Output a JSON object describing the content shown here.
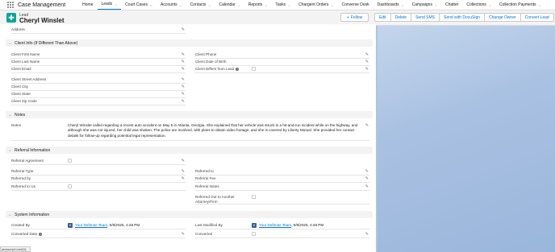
{
  "app": {
    "name": "Case Management"
  },
  "nav": [
    {
      "label": "Home",
      "dropdown": false
    },
    {
      "label": "Leads",
      "dropdown": true,
      "active": true
    },
    {
      "label": "Court Cases",
      "dropdown": true
    },
    {
      "label": "Accounts",
      "dropdown": true
    },
    {
      "label": "Contacts",
      "dropdown": true
    },
    {
      "label": "Calendar",
      "dropdown": true
    },
    {
      "label": "Reports",
      "dropdown": true
    },
    {
      "label": "Tasks",
      "dropdown": true
    },
    {
      "label": "Chargent Orders",
      "dropdown": true
    },
    {
      "label": "Converse Desk",
      "dropdown": false
    },
    {
      "label": "Dashboards",
      "dropdown": true
    },
    {
      "label": "Campaigns",
      "dropdown": true
    },
    {
      "label": "Chatter",
      "dropdown": false
    },
    {
      "label": "Collections",
      "dropdown": true
    },
    {
      "label": "Collection Payments",
      "dropdown": true
    }
  ],
  "record": {
    "type": "Lead",
    "name": "Cheryl Winslet",
    "follow": "Follow",
    "actions": [
      "Edit",
      "Delete",
      "Send SMS",
      "Send with DocuSign",
      "Change Owner",
      "Convert Lead"
    ]
  },
  "fields": {
    "address": "Address"
  },
  "client_info": {
    "title": "Client Info (If Different Than Above)",
    "left": [
      "Client First Name",
      "Client Last Name",
      "Client Email",
      "Client Street Address",
      "Client City",
      "Client State",
      "Client Zip Code"
    ],
    "right": [
      "Client Phone",
      "Client Date of Birth",
      "Client Differs from Lead"
    ]
  },
  "notes": {
    "title": "Notes",
    "label": "Notes",
    "text": "Cheryl Winslet called regarding a recent auto accident on May 5 in Atlanta, Georgia. She explained that her vehicle was struck in a hit-and-run incident while on the highway, and although she was not injured, her child was shaken. The police are involved, with plans to obtain video footage, and she is covered by Liberty Mutual. She provided her contact details for follow-up regarding potential legal representation."
  },
  "referral": {
    "title": "Referral Information",
    "left": [
      "Referral Agreement",
      "Referral Type",
      "Referred by",
      "Referred to Us"
    ],
    "right": [
      "Referred to",
      "Referral Fee",
      "Referral Notes",
      "Referred Out to Another Attorney/Firm"
    ]
  },
  "system": {
    "title": "System Information",
    "created_by_label": "Created By",
    "created_by_user": "Your Defense Team",
    "created_by_date": ", 5/8/2025, 4:48 PM",
    "modified_label": "Last Modified By",
    "modified_user": "Your Defense Team",
    "modified_date": ", 5/8/2025, 4:48 PM",
    "converted_date_label": "Converted Date",
    "converted_label": "Converted"
  },
  "status_bar": "javascript:void(0);"
}
